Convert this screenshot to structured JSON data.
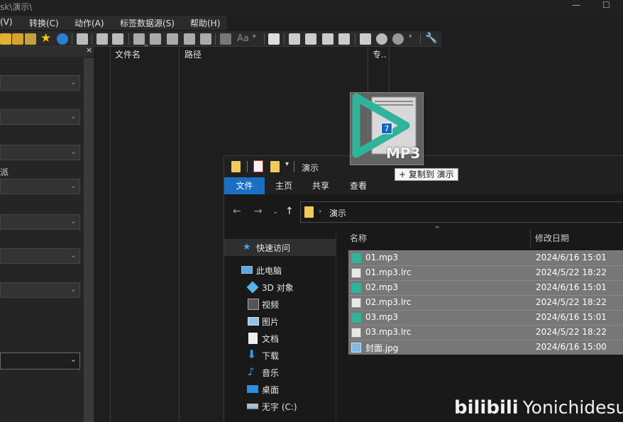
{
  "mp3tag": {
    "title_fragment": "sk\\演示\\",
    "menu": [
      {
        "label": "(V)"
      },
      {
        "label": "转换(C)"
      },
      {
        "label": "动作(A)"
      },
      {
        "label": "标签数据源(S)"
      },
      {
        "label": "帮助(H)"
      }
    ],
    "left_panel": {
      "label_fragment": "派"
    },
    "file_list": {
      "columns": [
        "文件名",
        "路径",
        "专.."
      ]
    }
  },
  "drag": {
    "count": "7",
    "format_label": "MP3",
    "tooltip": "+ 复制到 演示"
  },
  "explorer": {
    "title": "演示",
    "ribbon_tabs": [
      "文件",
      "主页",
      "共享",
      "查看"
    ],
    "address": {
      "current": "演示"
    },
    "nav": [
      {
        "label": "快速访问",
        "icon": "star-icon"
      },
      {
        "label": "此电脑",
        "icon": "computer-icon"
      },
      {
        "label": "3D 对象",
        "icon": "cube-icon"
      },
      {
        "label": "视频",
        "icon": "video-icon"
      },
      {
        "label": "图片",
        "icon": "picture-icon"
      },
      {
        "label": "文档",
        "icon": "document-icon"
      },
      {
        "label": "下载",
        "icon": "download-icon"
      },
      {
        "label": "音乐",
        "icon": "music-icon"
      },
      {
        "label": "桌面",
        "icon": "desktop-icon"
      },
      {
        "label": "无字 (C:)",
        "icon": "drive-icon"
      }
    ],
    "columns": {
      "name": "名称",
      "modified": "修改日期"
    },
    "files": [
      {
        "name": "01.mp3",
        "date": "2024/6/16 15:01",
        "icon": "mp3-file-icon"
      },
      {
        "name": "01.mp3.lrc",
        "date": "2024/5/22 18:22",
        "icon": "text-file-icon"
      },
      {
        "name": "02.mp3",
        "date": "2024/6/16 15:01",
        "icon": "mp3-file-icon"
      },
      {
        "name": "02.mp3.lrc",
        "date": "2024/5/22 18:22",
        "icon": "text-file-icon"
      },
      {
        "name": "03.mp3",
        "date": "2024/6/16 15:01",
        "icon": "mp3-file-icon"
      },
      {
        "name": "03.mp3.lrc",
        "date": "2024/5/22 18:22",
        "icon": "text-file-icon"
      },
      {
        "name": "封面.jpg",
        "date": "2024/6/16 15:00",
        "icon": "image-file-icon"
      }
    ]
  },
  "watermark": {
    "brand": "bilibili",
    "user": "Yonichidesu"
  },
  "colors": {
    "accent": "#1a6fc4",
    "selection": "#777777",
    "mp3_green": "#2fb39a"
  }
}
